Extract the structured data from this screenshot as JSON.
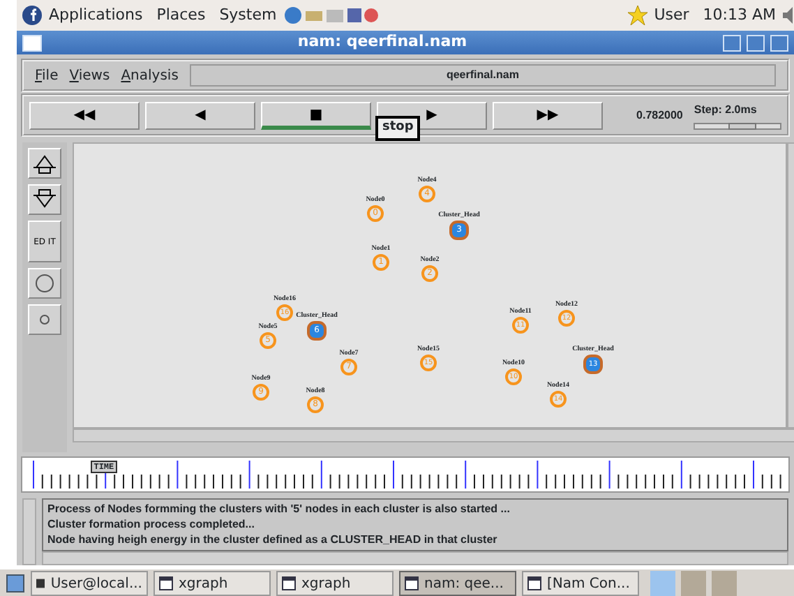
{
  "top_panel": {
    "menus": [
      "Applications",
      "Places",
      "System"
    ],
    "user": "User",
    "clock": "10:13 AM"
  },
  "window": {
    "title": "nam: qeerfinal.nam"
  },
  "menu_bar": {
    "items": [
      "File",
      "Views",
      "Analysis"
    ],
    "file_name": "qeerfinal.nam"
  },
  "controls": {
    "buttons": [
      {
        "glyph": "◀◀",
        "selected": false
      },
      {
        "glyph": "◀",
        "selected": false
      },
      {
        "glyph": "■",
        "selected": true
      },
      {
        "glyph": "▶",
        "selected": false
      },
      {
        "glyph": "▶▶",
        "selected": false
      }
    ],
    "tooltip": "stop",
    "time": "0.782000",
    "step": {
      "label": "Step: 2.0ms",
      "level": 0.55
    }
  },
  "side_tools": [
    {
      "kind": "zoom_in"
    },
    {
      "kind": "zoom_out"
    },
    {
      "kind": "edit",
      "label": "ED IT"
    },
    {
      "kind": "big_circle"
    },
    {
      "kind": "small_circle"
    }
  ],
  "nodes": [
    {
      "label": "Node4",
      "number": "4",
      "kind": "node"
    },
    {
      "label": "Node0",
      "number": "0",
      "kind": "node"
    },
    {
      "label": "Cluster_Head",
      "number": "3",
      "kind": "cluster_head"
    },
    {
      "label": "Node1",
      "number": "1",
      "kind": "node"
    },
    {
      "label": "Node2",
      "number": "2",
      "kind": "node"
    },
    {
      "label": "Node16",
      "number": "16",
      "kind": "node"
    },
    {
      "label": "Cluster_Head",
      "number": "6",
      "kind": "cluster_head"
    },
    {
      "label": "Node5",
      "number": "5",
      "kind": "node"
    },
    {
      "label": "Node11",
      "number": "11",
      "kind": "node"
    },
    {
      "label": "Node12",
      "number": "12",
      "kind": "node"
    },
    {
      "label": "Node15",
      "number": "15",
      "kind": "node"
    },
    {
      "label": "Node7",
      "number": "7",
      "kind": "node"
    },
    {
      "label": "Cluster_Head",
      "number": "13",
      "kind": "cluster_head"
    },
    {
      "label": "Node10",
      "number": "10",
      "kind": "node"
    },
    {
      "label": "Node9",
      "number": "9",
      "kind": "node"
    },
    {
      "label": "Node14",
      "number": "14",
      "kind": "node"
    },
    {
      "label": "Node8",
      "number": "8",
      "kind": "node"
    }
  ],
  "timeline": {
    "marker": "TIME",
    "level": 0.09
  },
  "log": [
    "Process of Nodes formming the clusters with '5' nodes in each cluster is also started ...",
    "Cluster formation process completed...",
    "Node having heigh energy in the cluster defined as a CLUSTER_HEAD in that cluster"
  ],
  "taskbar": [
    {
      "label": "User@local...",
      "kind": "terminal",
      "selected": false
    },
    {
      "label": "xgraph",
      "kind": "window",
      "selected": false
    },
    {
      "label": "xgraph",
      "kind": "window",
      "selected": false
    },
    {
      "label": "nam: qee...",
      "kind": "window",
      "selected": true
    },
    {
      "label": "[Nam Con...",
      "kind": "window",
      "selected": false
    }
  ]
}
